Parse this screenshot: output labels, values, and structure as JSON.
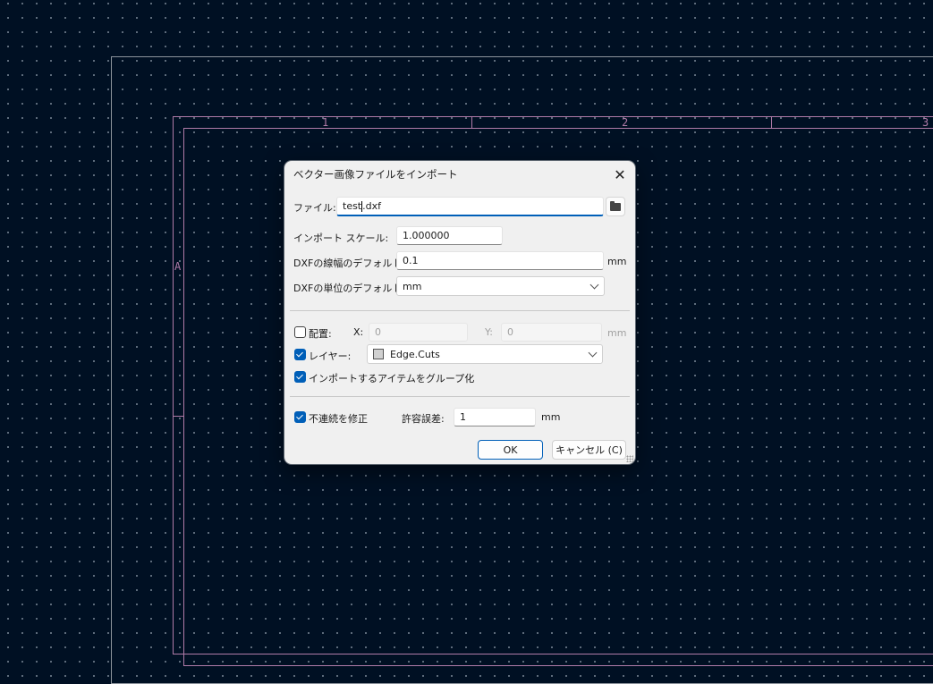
{
  "canvas": {
    "zone_labels": {
      "col1": "1",
      "col2": "2",
      "col3": "3",
      "rowA": "A"
    },
    "colors": {
      "background": "#001023",
      "sheet_border": "#b07ba8",
      "page_frame": "#8d949c"
    }
  },
  "dialog": {
    "title": "ベクター画像ファイルをインポート",
    "close_icon": "close-icon",
    "file": {
      "label": "ファイル:",
      "value_before_caret": "test",
      "value_after_caret": ".dxf",
      "browse_icon": "folder-icon"
    },
    "import_scale": {
      "label": "インポート スケール:",
      "value": "1.000000"
    },
    "dxf_line_width": {
      "label": "DXFの線幅のデフォルト:",
      "value": "0.1",
      "unit": "mm"
    },
    "dxf_units": {
      "label": "DXFの単位のデフォルト:",
      "value": "mm"
    },
    "placement": {
      "label": "配置:",
      "checked": false,
      "x_label": "X:",
      "x_value": "0",
      "y_label": "Y:",
      "y_value": "0",
      "unit": "mm"
    },
    "layer": {
      "label": "レイヤー:",
      "checked": true,
      "value": "Edge.Cuts",
      "swatch_color": "#d0d0d0"
    },
    "group_items": {
      "label": "インポートするアイテムをグループ化",
      "checked": true
    },
    "fix_discontinuities": {
      "label": "不連続を修正",
      "checked": true
    },
    "tolerance": {
      "label": "許容誤差:",
      "value": "1",
      "unit": "mm"
    },
    "buttons": {
      "ok": "OK",
      "cancel": "キャンセル (C)"
    },
    "accent_color": "#005fb8"
  }
}
